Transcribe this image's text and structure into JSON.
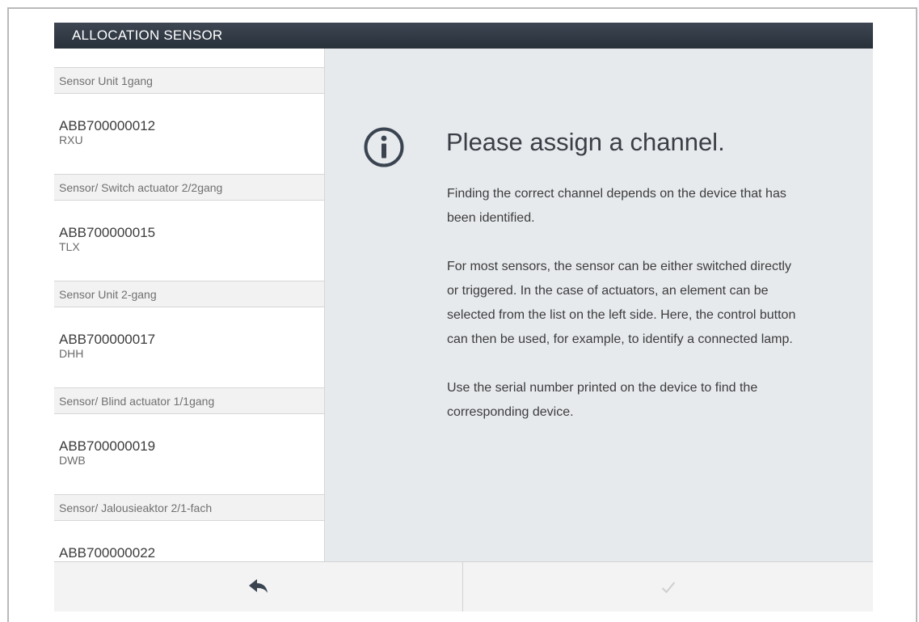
{
  "window": {
    "title": "ALLOCATION SENSOR"
  },
  "sidebar": {
    "groups": [
      {
        "header": "Sensor Unit 1gang",
        "serial": "ABB700000012",
        "type": "RXU"
      },
      {
        "header": "Sensor/ Switch actuator 2/2gang",
        "serial": "ABB700000015",
        "type": "TLX"
      },
      {
        "header": "Sensor Unit 2-gang",
        "serial": "ABB700000017",
        "type": "DHH"
      },
      {
        "header": "Sensor/ Blind actuator 1/1gang",
        "serial": "ABB700000019",
        "type": "DWB"
      },
      {
        "header": "Sensor/ Jalousieaktor 2/1-fach",
        "serial": "ABB700000022",
        "type": ""
      }
    ]
  },
  "main": {
    "icon": "info-icon",
    "title": "Please assign a channel.",
    "paragraphs": [
      "Finding the correct channel depends on the device that has been identified.",
      "For most sensors, the sensor can be either switched directly or triggered. In the case of actuators, an element can be selected from the list on the left side. Here, the control button can then be used, for example, to identify a connected lamp.",
      "Use the serial number printed on the device to find the corresponding device."
    ]
  },
  "footer": {
    "back_icon": "back-arrow-icon",
    "confirm_icon": "checkmark-icon",
    "confirm_enabled": false
  },
  "colors": {
    "titlebar": "#2d3540",
    "content_bg": "#e7eaed",
    "icon": "#3a4450"
  }
}
